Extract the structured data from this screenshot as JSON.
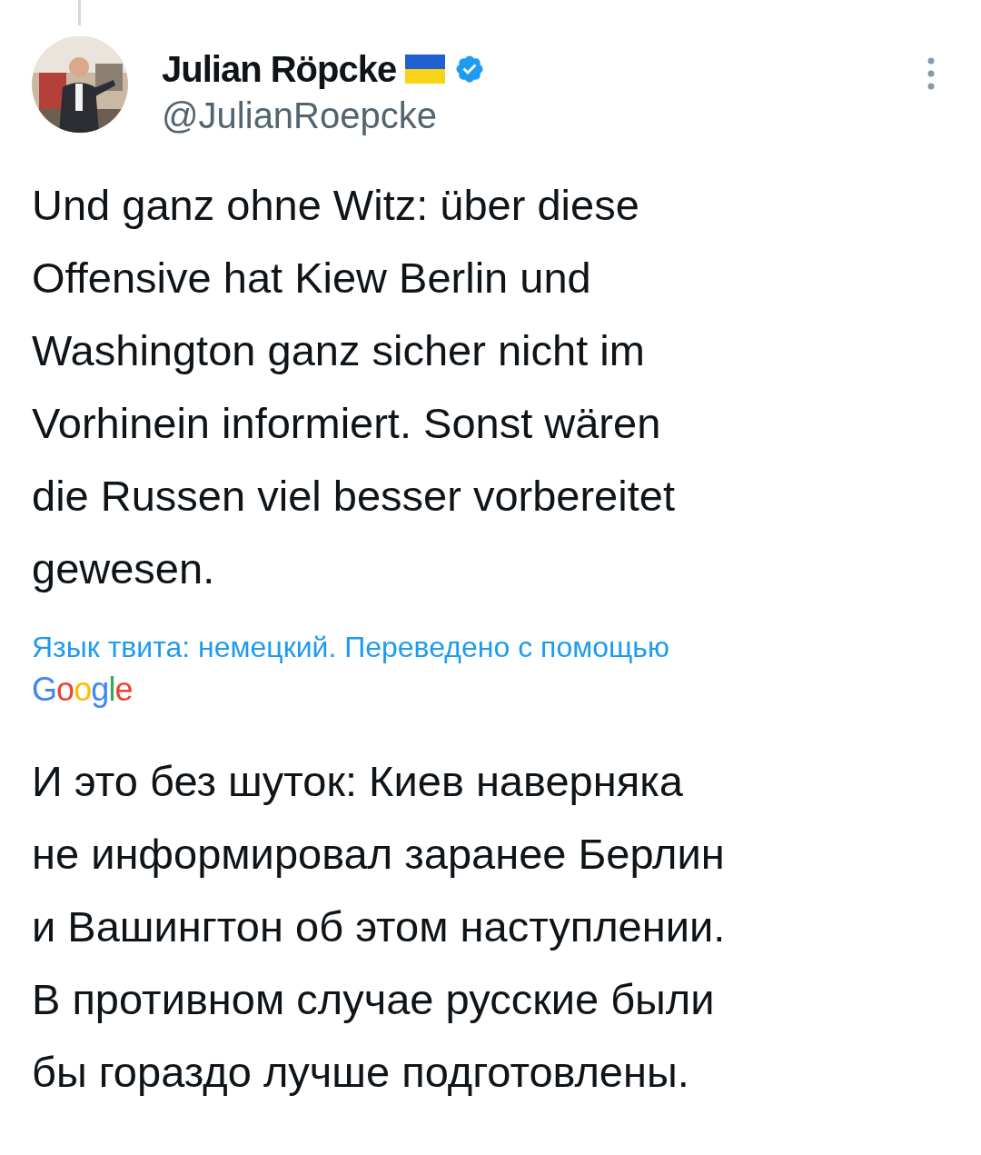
{
  "author": {
    "name": "Julian Röpcke",
    "handle": "@JulianRoepcke",
    "verified": true
  },
  "tweet_lines": [
    "Und ganz ohne Witz: über diese",
    "Offensive hat Kiew Berlin und",
    "Washington ganz sicher nicht im",
    "Vorhinein informiert. Sonst wären",
    "die Russen viel besser vorbereitet",
    "gewesen."
  ],
  "translation_note": "Язык твита: немецкий. Переведено с помощью",
  "translation_provider": "Google",
  "translation_lines": [
    "И это без шуток: Киев наверняка",
    "не информировал заранее Берлин",
    "и Вашингтон об этом наступлении.",
    "В противном случае русские были",
    "бы гораздо лучше подготовлены."
  ]
}
